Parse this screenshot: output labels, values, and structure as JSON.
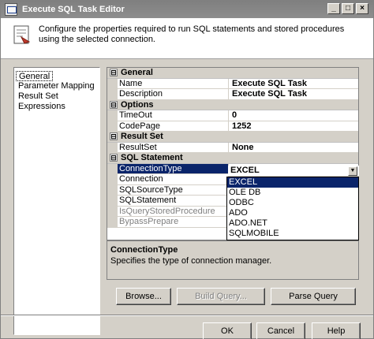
{
  "window": {
    "title": "Execute SQL Task Editor",
    "buttons": [
      "_",
      "□",
      "×"
    ]
  },
  "header": {
    "description": "Configure the properties required to run SQL statements and stored procedures using the selected connection."
  },
  "nav": {
    "items": [
      {
        "label": "General",
        "selected": true
      },
      {
        "label": "Parameter Mapping"
      },
      {
        "label": "Result Set"
      },
      {
        "label": "Expressions"
      }
    ]
  },
  "grid": {
    "sections": [
      {
        "name": "General",
        "toggle": "⊟",
        "rows": [
          {
            "name": "Name",
            "value": "Execute SQL Task"
          },
          {
            "name": "Description",
            "value": "Execute SQL Task"
          }
        ]
      },
      {
        "name": "Options",
        "toggle": "⊟",
        "rows": [
          {
            "name": "TimeOut",
            "value": "0"
          },
          {
            "name": "CodePage",
            "value": "1252"
          }
        ]
      },
      {
        "name": "Result Set",
        "toggle": "⊟",
        "rows": [
          {
            "name": "ResultSet",
            "value": "None"
          }
        ]
      },
      {
        "name": "SQL Statement",
        "toggle": "⊟",
        "rows": [
          {
            "name": "ConnectionType",
            "value": "EXCEL"
          },
          {
            "name": "Connection",
            "value": ""
          },
          {
            "name": "SQLSourceType",
            "value": ""
          },
          {
            "name": "SQLStatement",
            "value": ""
          },
          {
            "name": "IsQueryStoredProcedure",
            "value": ""
          },
          {
            "name": "BypassPrepare",
            "value": ""
          }
        ]
      }
    ]
  },
  "combo": {
    "value": "EXCEL",
    "options": [
      "EXCEL",
      "OLE DB",
      "ODBC",
      "ADO",
      "ADO.NET",
      "SQLMOBILE"
    ]
  },
  "description_panel": {
    "title": "ConnectionType",
    "text": "Specifies the type of connection manager."
  },
  "buttons": {
    "browse": "Browse...",
    "build_query": "Build Query...",
    "parse_query": "Parse Query",
    "ok": "OK",
    "cancel": "Cancel",
    "help": "Help"
  },
  "colors": {
    "selection": "#0a246a",
    "face": "#d4d0c8"
  }
}
